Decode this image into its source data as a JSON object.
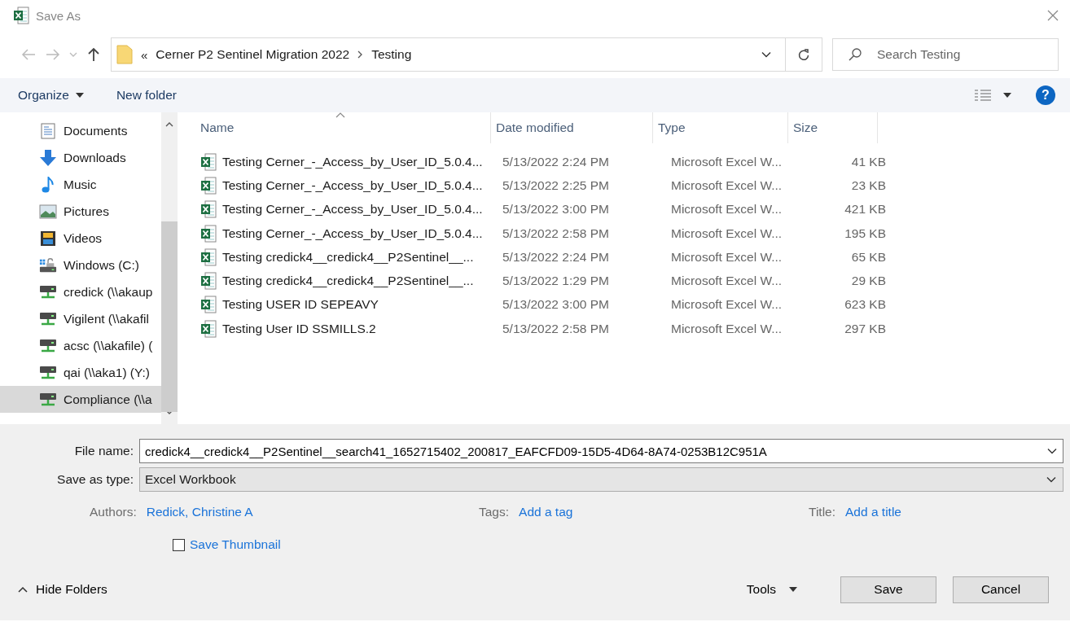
{
  "window": {
    "title": "Save As"
  },
  "address": {
    "overflow_marker": "«",
    "crumbs": [
      "Cerner P2 Sentinel Migration 2022",
      "Testing"
    ]
  },
  "search": {
    "placeholder": "Search Testing"
  },
  "toolbar": {
    "organize": "Organize",
    "new_folder": "New folder",
    "help": "?"
  },
  "sidebar": {
    "items": [
      {
        "label": "Documents",
        "kind": "documents",
        "selected": false
      },
      {
        "label": "Downloads",
        "kind": "downloads",
        "selected": false
      },
      {
        "label": "Music",
        "kind": "music",
        "selected": false
      },
      {
        "label": "Pictures",
        "kind": "pictures",
        "selected": false
      },
      {
        "label": "Videos",
        "kind": "videos",
        "selected": false
      },
      {
        "label": "Windows (C:)",
        "kind": "drive",
        "selected": false
      },
      {
        "label": "credick (\\\\akaup",
        "kind": "network",
        "selected": false
      },
      {
        "label": "Vigilent (\\\\akafil",
        "kind": "network",
        "selected": false
      },
      {
        "label": "acsc (\\\\akafile) (",
        "kind": "network",
        "selected": false
      },
      {
        "label": "qai (\\\\aka1) (Y:)",
        "kind": "network",
        "selected": false
      },
      {
        "label": "Compliance (\\\\a",
        "kind": "network",
        "selected": true
      }
    ]
  },
  "table": {
    "columns": [
      "Name",
      "Date modified",
      "Type",
      "Size"
    ],
    "rows": [
      {
        "name": "Testing Cerner_-_Access_by_User_ID_5.0.4...",
        "date": "5/13/2022 2:24 PM",
        "type": "Microsoft Excel W...",
        "size": "41 KB"
      },
      {
        "name": "Testing Cerner_-_Access_by_User_ID_5.0.4...",
        "date": "5/13/2022 2:25 PM",
        "type": "Microsoft Excel W...",
        "size": "23 KB"
      },
      {
        "name": "Testing Cerner_-_Access_by_User_ID_5.0.4...",
        "date": "5/13/2022 3:00 PM",
        "type": "Microsoft Excel W...",
        "size": "421 KB"
      },
      {
        "name": "Testing Cerner_-_Access_by_User_ID_5.0.4...",
        "date": "5/13/2022 2:58 PM",
        "type": "Microsoft Excel W...",
        "size": "195 KB"
      },
      {
        "name": "Testing credick4__credick4__P2Sentinel__...",
        "date": "5/13/2022 2:24 PM",
        "type": "Microsoft Excel W...",
        "size": "65 KB"
      },
      {
        "name": "Testing credick4__credick4__P2Sentinel__...",
        "date": "5/13/2022 1:29 PM",
        "type": "Microsoft Excel W...",
        "size": "29 KB"
      },
      {
        "name": "Testing USER ID SEPEAVY",
        "date": "5/13/2022 3:00 PM",
        "type": "Microsoft Excel W...",
        "size": "623 KB"
      },
      {
        "name": "Testing User ID SSMILLS.2",
        "date": "5/13/2022 2:58 PM",
        "type": "Microsoft Excel W...",
        "size": "297 KB"
      }
    ]
  },
  "form": {
    "file_name": {
      "label": "File name:",
      "value": "credick4__credick4__P2Sentinel__search41_1652715402_200817_EAFCFD09-15D5-4D64-8A74-0253B12C951A"
    },
    "save_as_type": {
      "label": "Save as type:",
      "value": "Excel Workbook"
    },
    "meta": [
      {
        "label": "Authors:",
        "value": "Redick, Christine A"
      },
      {
        "label": "Tags:",
        "value": "Add a tag"
      },
      {
        "label": "Title:",
        "value": "Add a title"
      }
    ],
    "save_thumbnail": {
      "label": "Save Thumbnail",
      "checked": false
    }
  },
  "footer": {
    "hide_folders": "Hide Folders",
    "tools": "Tools",
    "buttons": [
      "Save",
      "Cancel"
    ]
  }
}
